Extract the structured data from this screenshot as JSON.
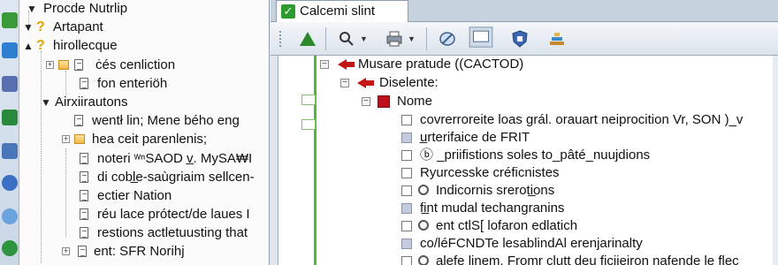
{
  "tree": {
    "items": [
      {
        "label": "Procde Nutrlip"
      },
      {
        "label": "Artapant"
      },
      {
        "label": "hirollecque"
      },
      {
        "label": "ċés cenliction"
      },
      {
        "label": "fon enteriöh"
      },
      {
        "label": "Airxiirautons"
      },
      {
        "label": "wentł lin; Mene bého eng"
      },
      {
        "label": "hea ceit parenlenis;"
      },
      {
        "label": "noteri ʷⁿSAOD v̲.  MySA₩I"
      },
      {
        "label": "di cobl̲e-saùgriaim sellcen-"
      },
      {
        "label": "ectier Nation"
      },
      {
        "label": "réu lace prótect/de laues I"
      },
      {
        "label": "restions actletuusting that"
      },
      {
        "label": "ent: SFR Norihj"
      }
    ]
  },
  "tab": {
    "label": "Calcemi slint"
  },
  "toolbar": {
    "icons": [
      "green-triangle-icon",
      "magnifier-icon",
      "printer-icon",
      "pencil-icon",
      "monitor-icon",
      "shield-icon",
      "stack-icon"
    ]
  },
  "content": {
    "root_label": "Musare pratude ((CACTOD)",
    "child_label": "Diselente:",
    "node_label": "Nome",
    "items": [
      {
        "label": "covrerroreite loas grál. orauart neiprocition Vr, SON )_v",
        "filled": false,
        "gear": false
      },
      {
        "label": "u̲rterifaice de FRIT",
        "filled": true,
        "gear": false
      },
      {
        "label": "ⓑ _priifistions soles to_pâté_nuujdions",
        "filled": false,
        "gear": false
      },
      {
        "label": "Ryurcesske créficnistes",
        "filled": false,
        "gear": false
      },
      {
        "label": "Indicornis sreroti̲ons",
        "filled": false,
        "gear": true
      },
      {
        "label": "fi̲nt mudal techangranins",
        "filled": true,
        "gear": false
      },
      {
        "label": "ent ctlS[ lofaron edlatich",
        "filled": false,
        "gear": true
      },
      {
        "label": "co/léFCNDTe lesablindAl erenjarinalty",
        "filled": true,
        "gear": false
      },
      {
        "label": "alefe linem. Fromr clutt deu ficiieiron nafende le flec",
        "filled": false,
        "gear": true
      }
    ]
  },
  "colors": {
    "accent_green": "#54b534",
    "arrow_red": "#c41515"
  }
}
